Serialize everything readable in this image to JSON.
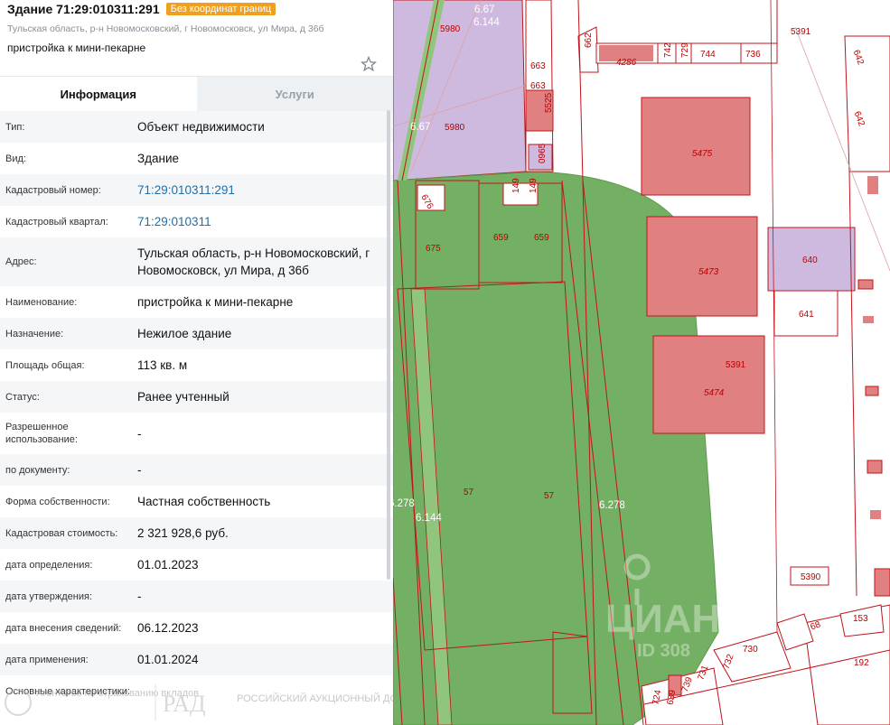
{
  "header": {
    "title": "Здание 71:29:010311:291",
    "badge": "Без координат границ",
    "address": "Тульская область, р-н Новомосковский, г Новомосковск, ул Мира, д 36б",
    "name": "пристройка к мини-пекарне"
  },
  "tabs": [
    {
      "label": "Информация",
      "active": true
    },
    {
      "label": "Услуги",
      "active": false
    }
  ],
  "rows": [
    {
      "label": "Тип:",
      "value": "Объект недвижимости",
      "link": false
    },
    {
      "label": "Вид:",
      "value": "Здание",
      "link": false
    },
    {
      "label": "Кадастровый номер:",
      "value": "71:29:010311:291",
      "link": true
    },
    {
      "label": "Кадастровый квартал:",
      "value": "71:29:010311",
      "link": true
    },
    {
      "label": "Адрес:",
      "value": "Тульская область, р-н Новомосковский, г Новомосковск, ул Мира, д 36б",
      "link": false
    },
    {
      "label": "Наименование:",
      "value": "пристройка к мини-пекарне",
      "link": false
    },
    {
      "label": "Назначение:",
      "value": "Нежилое здание",
      "link": false
    },
    {
      "label": "Площадь общая:",
      "value": "113 кв. м",
      "link": false
    },
    {
      "label": "Статус:",
      "value": "Ранее учтенный",
      "link": false
    },
    {
      "label": "Разрешенное использование:",
      "value": "-",
      "link": false
    },
    {
      "label": "по документу:",
      "value": "-",
      "link": false
    },
    {
      "label": "Форма собственности:",
      "value": "Частная собственность",
      "link": false
    },
    {
      "label": "Кадастровая стоимость:",
      "value": "2 321 928,6 руб.",
      "link": false
    },
    {
      "label": "дата определения:",
      "value": "01.01.2023",
      "link": false
    },
    {
      "label": "дата утверждения:",
      "value": "-",
      "link": false
    },
    {
      "label": "дата внесения сведений:",
      "value": "06.12.2023",
      "link": false
    },
    {
      "label": "дата применения:",
      "value": "01.01.2024",
      "link": false
    },
    {
      "label": "Основные характеристики:",
      "value": "",
      "link": false
    }
  ],
  "map_labels": [
    "6.67",
    "6.144",
    "5980",
    "662",
    "5391",
    "642",
    "663",
    "4286",
    "742",
    "729",
    "744",
    "736",
    "5525",
    "5475",
    "0965",
    "676",
    "149",
    "675",
    "659",
    "5473",
    "640",
    "641",
    "5474",
    "57",
    "6.278",
    "5390",
    "68",
    "153",
    "730",
    "192",
    "732",
    "731",
    "739",
    "724",
    "639"
  ],
  "watermarks": {
    "agency": "Агентство по страхованию вкладов",
    "rad_logo": "РАД",
    "rad_text": "РОССИЙСКИЙ АУКЦИОННЫЙ ДОМ",
    "cian": "ЦИАН",
    "cian_id": "ID 308"
  },
  "colors": {
    "green": "#74b063",
    "violet": "#cfbadf",
    "red_fill": "#e08080",
    "line": "#c0141c",
    "link": "#1f6fa5",
    "badge": "#f0a020"
  }
}
